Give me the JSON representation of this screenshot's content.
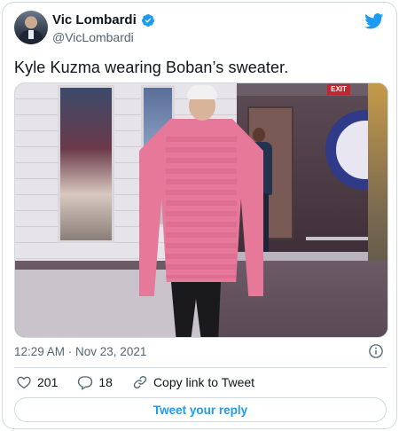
{
  "author": {
    "display_name": "Vic Lombardi",
    "handle": "@VicLombardi",
    "verified": true
  },
  "icons": {
    "verified": "verified-badge-icon",
    "brand": "twitter-bird-icon",
    "info": "info-icon",
    "like": "heart-icon",
    "reply": "reply-bubble-icon",
    "copy": "link-icon"
  },
  "tweet": {
    "text": "Kyle Kuzma wearing Boban’s sweater.",
    "timestamp": "12:29 AM · Nov 23, 2021"
  },
  "media": {
    "exit_sign": "EXIT"
  },
  "actions": {
    "likes_count": "201",
    "replies_count": "18",
    "copy_link_label": "Copy link to Tweet"
  },
  "reply_button": {
    "label": "Tweet your reply"
  },
  "colors": {
    "accent": "#1d9bf0",
    "verified": "#1d9bf0",
    "secondary_text": "#536471",
    "border": "#cfd9de"
  }
}
